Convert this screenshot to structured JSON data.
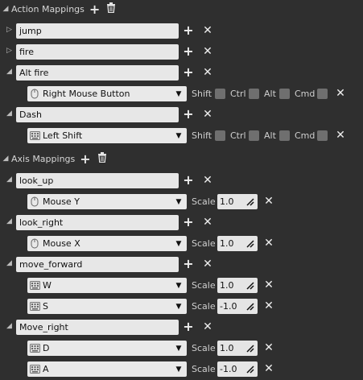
{
  "action_mappings": {
    "title": "Action Mappings",
    "items": [
      {
        "name": "jump",
        "expanded": false,
        "keys": []
      },
      {
        "name": "fire",
        "expanded": false,
        "keys": []
      },
      {
        "name": "Alt fire",
        "expanded": true,
        "keys": [
          {
            "key": "Right Mouse Button",
            "icon": "mouse-icon",
            "modifiers": [
              "Shift",
              "Ctrl",
              "Alt",
              "Cmd"
            ]
          }
        ]
      },
      {
        "name": "Dash",
        "expanded": true,
        "keys": [
          {
            "key": "Left Shift",
            "icon": "keyboard-icon",
            "modifiers": [
              "Shift",
              "Ctrl",
              "Alt",
              "Cmd"
            ]
          }
        ]
      }
    ]
  },
  "axis_mappings": {
    "title": "Axis Mappings",
    "scale_label": "Scale",
    "items": [
      {
        "name": "look_up",
        "keys": [
          {
            "key": "Mouse Y",
            "icon": "mouse-icon",
            "scale": "1.0"
          }
        ]
      },
      {
        "name": "look_right",
        "keys": [
          {
            "key": "Mouse X",
            "icon": "mouse-icon",
            "scale": "1.0"
          }
        ]
      },
      {
        "name": "move_forward",
        "keys": [
          {
            "key": "W",
            "icon": "keyboard-icon",
            "scale": "1.0"
          },
          {
            "key": "S",
            "icon": "keyboard-icon",
            "scale": "-1.0"
          }
        ]
      },
      {
        "name": "Move_right",
        "keys": [
          {
            "key": "D",
            "icon": "keyboard-icon",
            "scale": "1.0"
          },
          {
            "key": "A",
            "icon": "keyboard-icon",
            "scale": "-1.0"
          }
        ]
      }
    ]
  }
}
